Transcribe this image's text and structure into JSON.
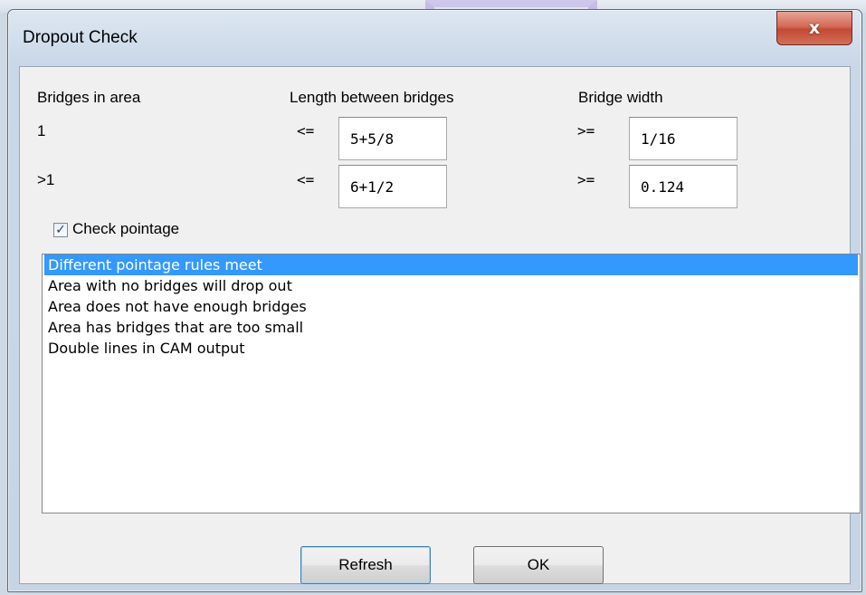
{
  "window": {
    "title": "Dropout Check",
    "close_glyph": "x"
  },
  "headers": {
    "bridges_in_area": "Bridges in area",
    "length_between_bridges": "Length between bridges",
    "bridge_width": "Bridge width"
  },
  "rows": [
    {
      "bridges": "1",
      "length_op": "<=",
      "length_value": "5+5/8",
      "width_op": ">=",
      "width_value": "1/16"
    },
    {
      "bridges": ">1",
      "length_op": "<=",
      "length_value": "6+1/2",
      "width_op": ">=",
      "width_value": "0.124"
    }
  ],
  "check_pointage": {
    "label": "Check pointage",
    "checked": true,
    "check_glyph": "✓"
  },
  "results": {
    "items": [
      "Different pointage rules meet",
      "Area with no bridges will drop out",
      "Area does not have enough bridges",
      "Area has bridges that are too small",
      "Double lines in CAM output"
    ],
    "selected_index": 0
  },
  "buttons": {
    "refresh": "Refresh",
    "ok": "OK"
  },
  "colors": {
    "selection": "#3399ff",
    "close_button": "#c14a33"
  }
}
